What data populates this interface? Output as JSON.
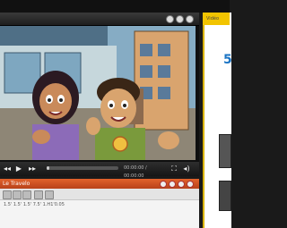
{
  "video_player": {
    "title": "",
    "controls": {
      "rewind": "◂◂",
      "play": "▶",
      "forward": "▸▸",
      "fullscreen": "⛶",
      "volume": "◂)"
    },
    "timecode": "00:00:00 / 00:00:00",
    "progress_percent": 2
  },
  "lower_window": {
    "title": "Le Travelo",
    "ruler": "1.5' 1.5'  1.5' 7.5' 1.H1'0.05"
  },
  "doc_window": {
    "title": "Vidéo",
    "heading": "5"
  },
  "colors": {
    "lower_titlebar": "#d4552a",
    "doc_accent": "#f2c400",
    "doc_heading": "#1b74c4"
  },
  "icons": [
    "close-icon",
    "minimize-icon",
    "maximize-icon",
    "play-icon",
    "rewind-icon",
    "forward-icon",
    "fullscreen-icon",
    "volume-icon"
  ]
}
